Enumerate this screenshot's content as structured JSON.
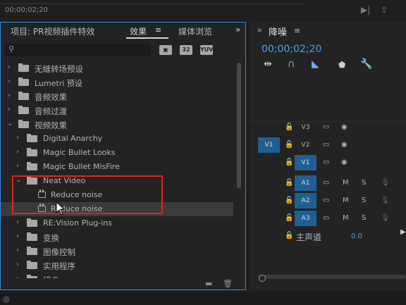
{
  "top": {
    "timecode": "00;00;02;20"
  },
  "project_panel": {
    "tabs": [
      {
        "label": "项目: PR视频插件特效"
      },
      {
        "label": "效果"
      },
      {
        "label": "媒体浏览"
      }
    ],
    "search": {
      "value": "",
      "placeholder": ""
    },
    "filter_icons": [
      "accelerated-effects-icon",
      "32",
      "YUV"
    ],
    "tree": [
      {
        "label": "无缝转场预设",
        "kind": "preset-folder",
        "expanded": false
      },
      {
        "label": "Lumetri 预设",
        "kind": "preset-folder",
        "expanded": false
      },
      {
        "label": "音频效果",
        "kind": "folder",
        "expanded": false
      },
      {
        "label": "音频过渡",
        "kind": "folder",
        "expanded": false
      },
      {
        "label": "视频效果",
        "kind": "folder",
        "expanded": true
      },
      {
        "label": "Digital Anarchy",
        "kind": "folder",
        "expanded": false
      },
      {
        "label": "Magic Bullet Looks",
        "kind": "folder",
        "expanded": false
      },
      {
        "label": "Magic Bullet MisFire",
        "kind": "folder",
        "expanded": false
      },
      {
        "label": "Neat Video",
        "kind": "folder",
        "expanded": true
      },
      {
        "label": "Reduce noise",
        "kind": "effect"
      },
      {
        "label": "Reduce noise",
        "kind": "effect",
        "hovered": true
      },
      {
        "label": "RE:Vision Plug-ins",
        "kind": "folder",
        "expanded": false
      },
      {
        "label": "变换",
        "kind": "folder",
        "expanded": false
      },
      {
        "label": "图像控制",
        "kind": "folder",
        "expanded": false
      },
      {
        "label": "实用程序",
        "kind": "folder",
        "expanded": false
      },
      {
        "label": "扭曲",
        "kind": "folder",
        "expanded": false
      }
    ]
  },
  "sequence_panel": {
    "title": "降噪",
    "timecode": "00;00;02;20",
    "tools": [
      "insert-edit-icon",
      "link-icon",
      "snap-icon",
      "marker-icon",
      "wrench-icon"
    ],
    "tracks": [
      {
        "label": "V3",
        "source": "",
        "type": "video"
      },
      {
        "label": "V2",
        "source": "V1",
        "type": "video"
      },
      {
        "label": "V1",
        "source": "",
        "type": "video"
      },
      {
        "label": "A1",
        "source": "",
        "type": "audio",
        "m": "M",
        "s": "S"
      },
      {
        "label": "A2",
        "source": "",
        "type": "audio",
        "m": "M",
        "s": "S"
      },
      {
        "label": "A3",
        "source": "",
        "type": "audio",
        "m": "M",
        "s": "S"
      }
    ],
    "master": {
      "label": "主声道",
      "value": "0.0"
    }
  },
  "colors": {
    "accent_blue": "#2d8ceb",
    "timecode_blue": "#4f9cf0",
    "highlight_red": "#e1251b",
    "track_blue": "#1f5f94"
  }
}
